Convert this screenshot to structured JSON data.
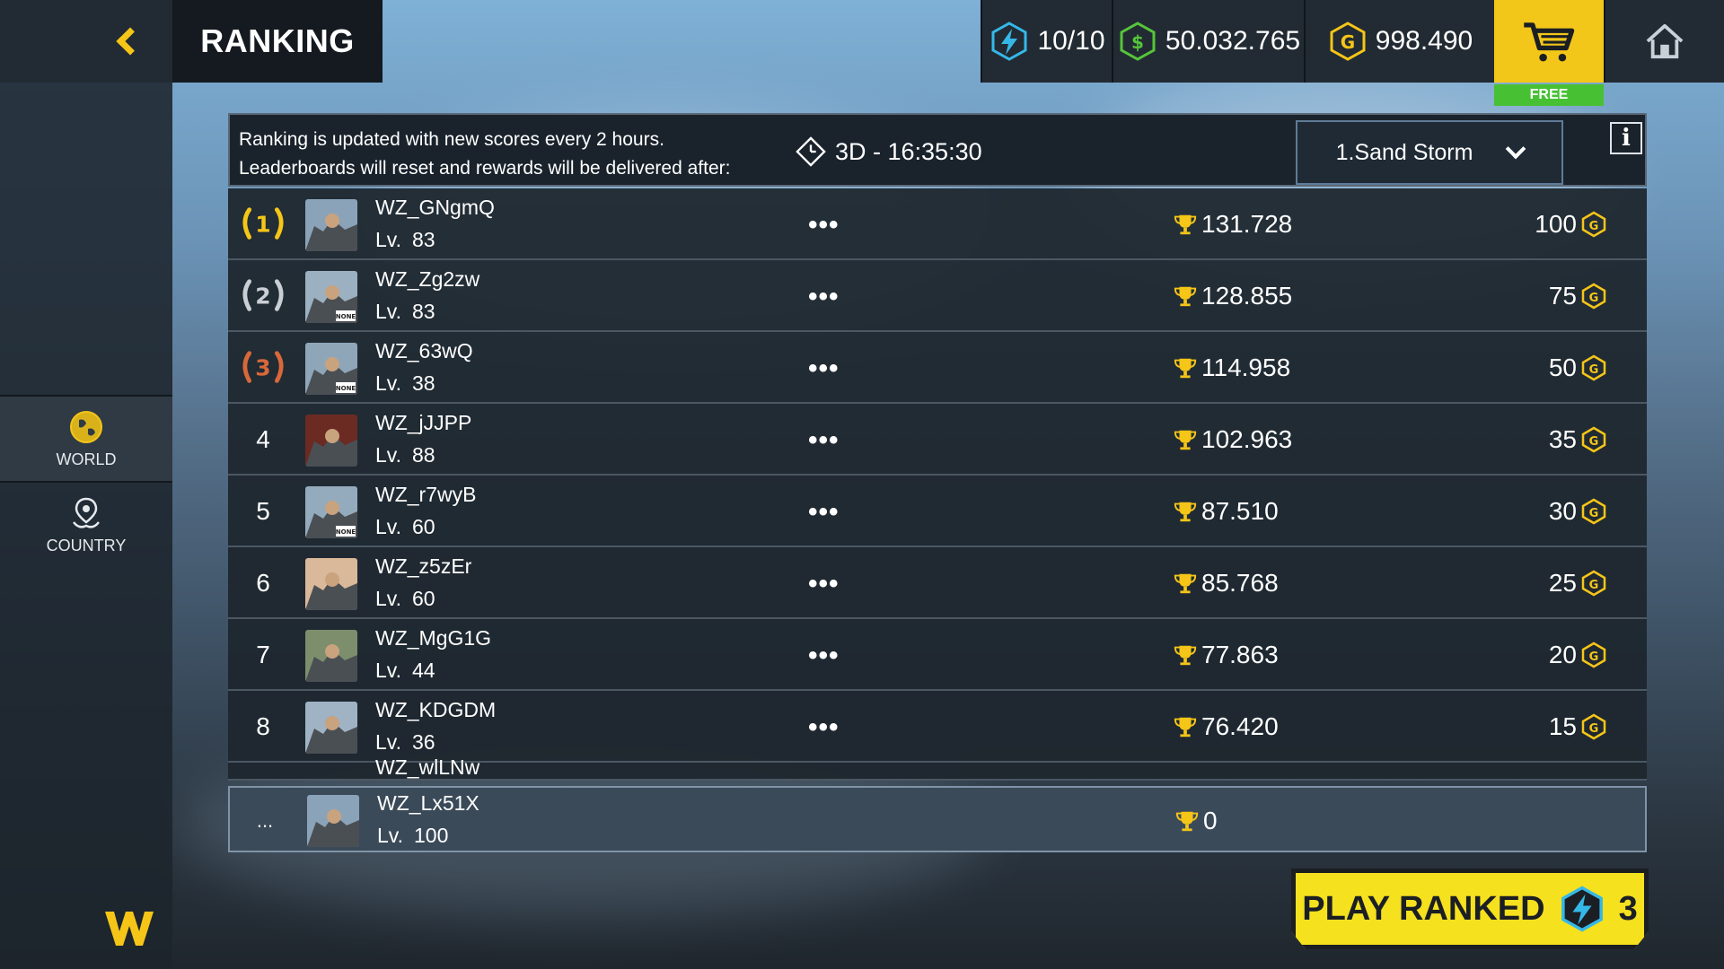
{
  "header": {
    "title": "RANKING",
    "energy": "10/10",
    "cash": "50.032.765",
    "gold": "998.490",
    "shop_tag": "FREE"
  },
  "sidebar": {
    "tabs": [
      {
        "label": "WORLD",
        "icon": "globe-icon"
      },
      {
        "label": "COUNTRY",
        "icon": "map-pin-icon"
      }
    ]
  },
  "info": {
    "line1": "Ranking is updated with new scores every 2 hours.",
    "line2": "Leaderboards will reset and rewards will be delivered after:",
    "timer": "3D - 16:35:30",
    "season": "1.Sand Storm",
    "info_label": "i"
  },
  "level_prefix": "Lv.",
  "more_label": "•••",
  "rows": [
    {
      "rank": "1",
      "name": "WZ_GNgmQ",
      "level": "83",
      "score": "131.728",
      "reward": "100"
    },
    {
      "rank": "2",
      "name": "WZ_Zg2zw",
      "level": "83",
      "score": "128.855",
      "reward": "75"
    },
    {
      "rank": "3",
      "name": "WZ_63wQ",
      "level": "38",
      "score": "114.958",
      "reward": "50"
    },
    {
      "rank": "4",
      "name": "WZ_jJJPP",
      "level": "88",
      "score": "102.963",
      "reward": "35"
    },
    {
      "rank": "5",
      "name": "WZ_r7wyB",
      "level": "60",
      "score": "87.510",
      "reward": "30"
    },
    {
      "rank": "6",
      "name": "WZ_z5zEr",
      "level": "60",
      "score": "85.768",
      "reward": "25"
    },
    {
      "rank": "7",
      "name": "WZ_MgG1G",
      "level": "44",
      "score": "77.863",
      "reward": "20"
    },
    {
      "rank": "8",
      "name": "WZ_KDGDM",
      "level": "36",
      "score": "76.420",
      "reward": "15"
    }
  ],
  "partial_row_name": "WZ_wlLNw",
  "my_row": {
    "rank": "...",
    "name": "WZ_Lx51X",
    "level": "100",
    "score": "0"
  },
  "play_button": {
    "label": "PLAY RANKED",
    "cost": "3"
  },
  "avatar_badges": [
    "",
    "NONE",
    "NONE",
    "",
    "NONE",
    "",
    "",
    ""
  ],
  "colors": {
    "gold": "#f5c518",
    "silver": "#c9cfd4",
    "bronze": "#d8683a",
    "accent_yellow": "#f5e11e",
    "free_green": "#47c133"
  }
}
